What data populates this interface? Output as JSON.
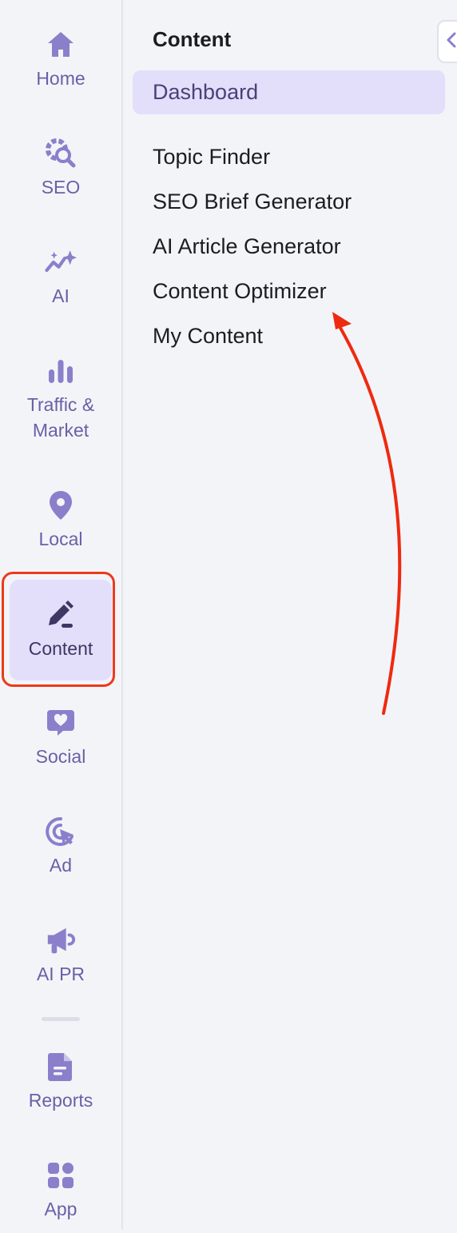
{
  "rail": {
    "items": [
      {
        "label": "Home",
        "icon": "home-icon"
      },
      {
        "label": "SEO",
        "icon": "seo-gear-search-icon"
      },
      {
        "label": "AI",
        "icon": "sparkle-chart-icon"
      },
      {
        "label": "Traffic &",
        "label2": "Market",
        "icon": "bar-chart-icon"
      },
      {
        "label": "Local",
        "icon": "map-pin-icon"
      },
      {
        "label": "Content",
        "icon": "pen-icon"
      },
      {
        "label": "Social",
        "icon": "chat-heart-icon"
      },
      {
        "label": "Ad",
        "icon": "cursor-target-icon"
      },
      {
        "label": "AI PR",
        "icon": "megaphone-icon"
      },
      {
        "label": "Reports",
        "icon": "document-icon"
      },
      {
        "label": "App",
        "icon": "apps-grid-icon"
      }
    ],
    "active": "Content"
  },
  "panel": {
    "title": "Content",
    "dashboard": "Dashboard",
    "links": [
      "Topic Finder",
      "SEO Brief Generator",
      "AI Article Generator",
      "Content Optimizer",
      "My Content"
    ]
  },
  "colors": {
    "icon": "#8b7fcb",
    "active_bg": "#e3defa",
    "highlight": "#ec3a1c",
    "arrow": "#ee2a10"
  }
}
